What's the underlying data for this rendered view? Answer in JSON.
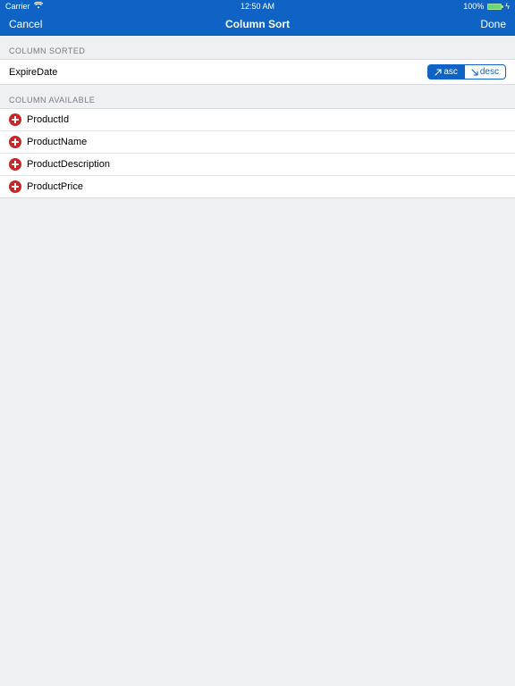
{
  "status": {
    "carrier": "Carrier",
    "time": "12:50 AM",
    "battery_pct": "100%"
  },
  "nav": {
    "cancel": "Cancel",
    "title": "Column Sort",
    "done": "Done"
  },
  "sorted_header": "COLUMN SORTED",
  "sorted": {
    "name": "ExpireDate",
    "asc": "asc",
    "desc": "desc",
    "direction": "asc"
  },
  "available_header": "COLUMN AVAILABLE",
  "available": [
    {
      "name": "ProductId"
    },
    {
      "name": "ProductName"
    },
    {
      "name": "ProductDescription"
    },
    {
      "name": "ProductPrice"
    }
  ]
}
